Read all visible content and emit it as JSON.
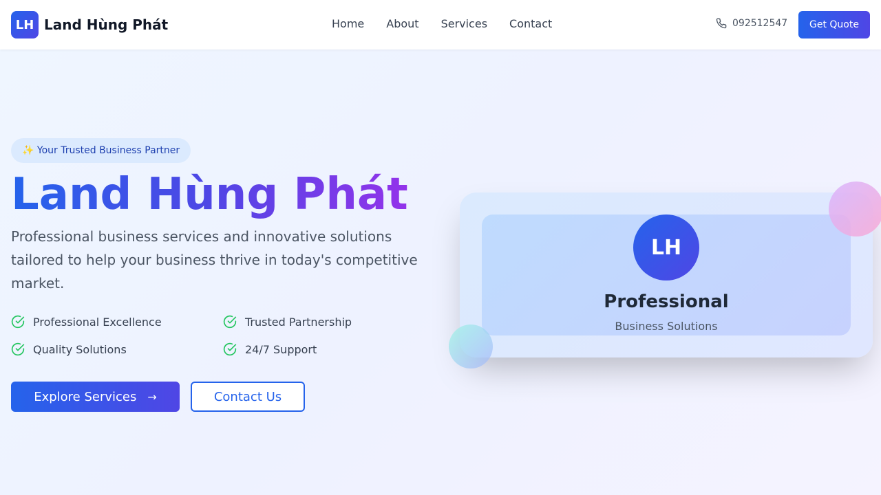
{
  "brand": {
    "logo_initials": "LH",
    "name": "Land Hùng Phát"
  },
  "nav": {
    "items": [
      {
        "label": "Home"
      },
      {
        "label": "About"
      },
      {
        "label": "Services"
      },
      {
        "label": "Contact"
      }
    ]
  },
  "header": {
    "phone": "092512547",
    "phone_icon": "phone-icon",
    "cta_label": "Get Quote"
  },
  "hero": {
    "badge": "✨ Your Trusted Business Partner",
    "title": "Land Hùng Phát",
    "description": "Professional business services and innovative solutions tailored to help your business thrive in today's competitive market.",
    "features": [
      {
        "label": "Professional Excellence",
        "icon": "check-circle-icon"
      },
      {
        "label": "Trusted Partnership",
        "icon": "check-circle-icon"
      },
      {
        "label": "Quality Solutions",
        "icon": "check-circle-icon"
      },
      {
        "label": "24/7 Support",
        "icon": "check-circle-icon"
      }
    ],
    "primary_button": "Explore Services",
    "primary_button_icon": "arrow-right-icon",
    "secondary_button": "Contact Us"
  },
  "card": {
    "initials": "LH",
    "title": "Professional",
    "subtitle": "Business Solutions"
  },
  "colors": {
    "primary": "#2563eb",
    "indigo": "#4f46e5",
    "purple": "#9333ea",
    "check": "#22c55e"
  }
}
